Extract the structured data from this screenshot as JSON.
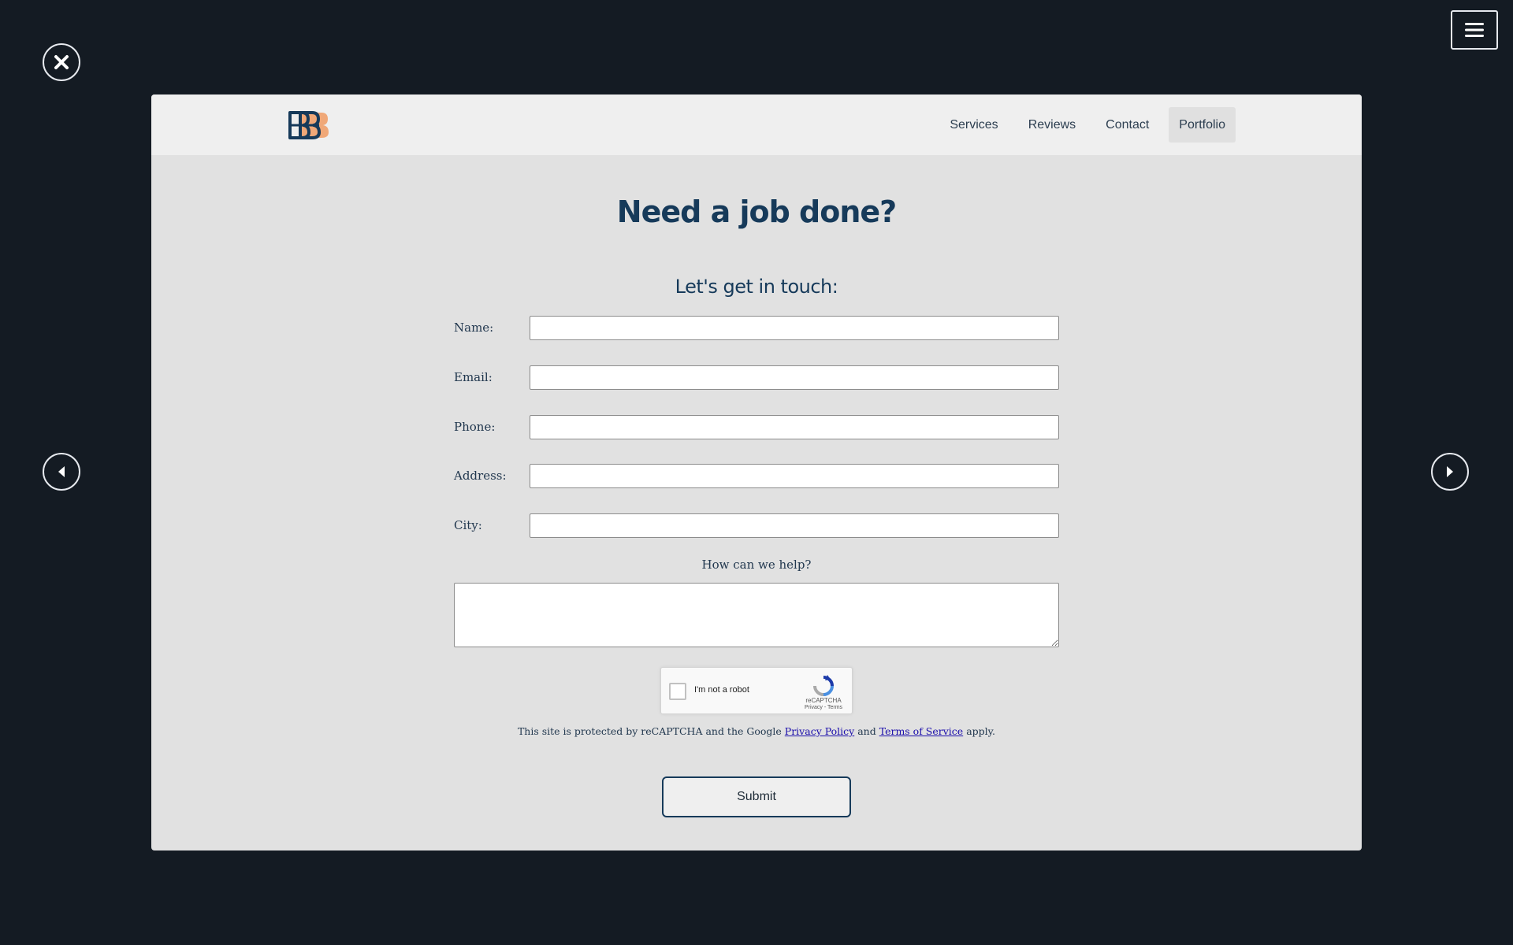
{
  "controls": {
    "close_icon": "close-icon",
    "menu_icon": "hamburger-menu-icon",
    "prev_icon": "arrow-left-icon",
    "next_icon": "arrow-right-icon"
  },
  "nav": {
    "items": [
      {
        "label": "Services"
      },
      {
        "label": "Reviews"
      },
      {
        "label": "Contact"
      },
      {
        "label": "Portfolio",
        "active": true
      }
    ]
  },
  "colors": {
    "background": "#141b23",
    "panel": "#e1e1e1",
    "navbar": "#efefef",
    "heading": "#163a5a",
    "logo_dark": "#163a5a",
    "logo_accent": "#f0a878"
  },
  "form": {
    "headline": "Need a job done?",
    "subheadline": "Let's get in touch:",
    "fields": [
      {
        "label": "Name:",
        "value": ""
      },
      {
        "label": "Email:",
        "value": ""
      },
      {
        "label": "Phone:",
        "value": ""
      },
      {
        "label": "Address:",
        "value": ""
      },
      {
        "label": "City:",
        "value": ""
      }
    ],
    "help_label": "How can we help?",
    "help_value": "",
    "recaptcha": {
      "label": "I'm not a robot",
      "brand": "reCAPTCHA",
      "links": "Privacy - Terms"
    },
    "protection": {
      "prefix": "This site is protected by reCAPTCHA and the Google",
      "privacy_link": "Privacy Policy",
      "and": "and",
      "terms_link": "Terms of Service",
      "suffix": "apply."
    },
    "submit_label": "Submit"
  }
}
